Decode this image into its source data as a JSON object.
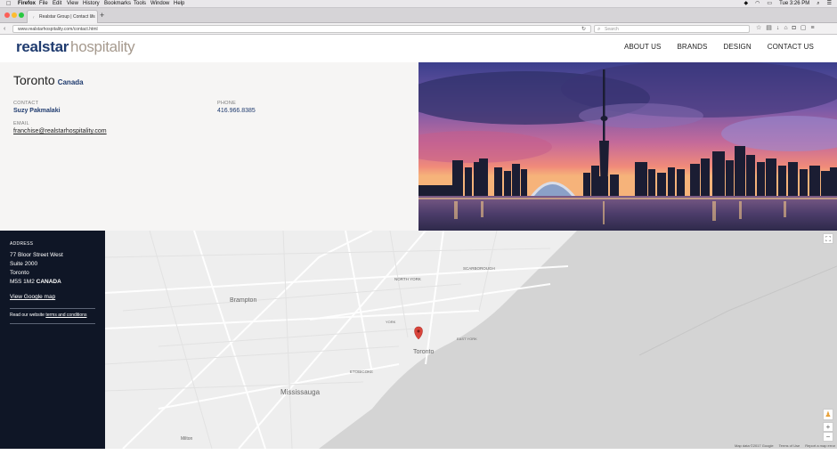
{
  "menubar": {
    "app": "Firefox",
    "items": [
      "File",
      "Edit",
      "View",
      "History",
      "Bookmarks",
      "Tools",
      "Window",
      "Help"
    ],
    "clock": "Tue 3:26 PM"
  },
  "browser": {
    "tab_title": "Realstar Group | Contact Us",
    "tab_close": "×",
    "new_tab": "+",
    "url": "www.realstarhospitality.com/contact.html",
    "search_placeholder": "Search",
    "back": "‹"
  },
  "site": {
    "logo_part1": "realstar",
    "logo_part2": "hospitality",
    "nav": [
      "ABOUT US",
      "BRANDS",
      "DESIGN",
      "CONTACT US"
    ]
  },
  "contact": {
    "city": "Toronto",
    "country": "Canada",
    "contact_label": "CONTACT",
    "contact_name": "Suzy Pakmalaki",
    "phone_label": "PHONE",
    "phone": "416.966.8385",
    "email_label": "EMAIL",
    "email": "franchise@realstarhospitality.com"
  },
  "address": {
    "label": "ADDRESS",
    "line1": "77 Bloor Street West",
    "line2": "Suite 2000",
    "line3": "Toronto",
    "postal": "M5S 1M2",
    "country": "CANADA",
    "map_link": "View Google map",
    "terms_prefix": "Read our website",
    "terms_link": "terms and conditions"
  },
  "map": {
    "labels": {
      "toronto": "Toronto",
      "mississauga": "Mississauga",
      "brampton": "Brampton",
      "north_york": "NORTH YORK",
      "scarborough": "SCARBOROUGH",
      "etobicoke": "ETOBICOKE",
      "york": "YORK",
      "milton": "Milton",
      "east_york": "EAST YORK"
    },
    "footer": [
      "Map data ©2017 Google",
      "Terms of Use",
      "Report a map error"
    ],
    "zoom_in": "+",
    "zoom_out": "−"
  },
  "colors": {
    "brand_navy": "#1f3b6f",
    "brand_taupe": "#a69a8e",
    "sidebar_bg": "#0f1626",
    "pin": "#d9443b"
  }
}
